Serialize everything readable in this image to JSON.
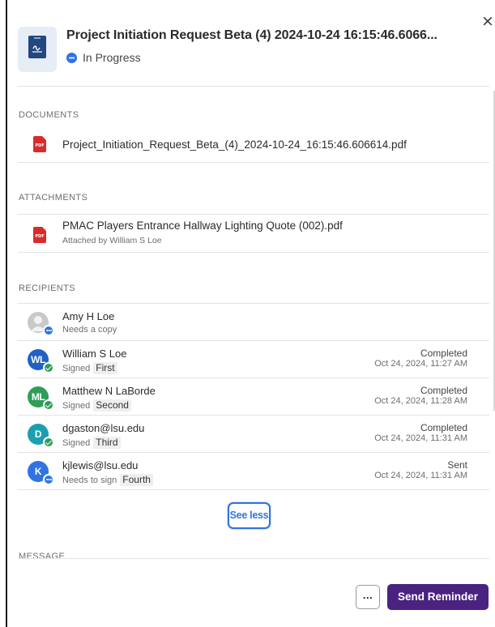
{
  "panel": {
    "close_glyph": "×",
    "title": "Project Initiation Request Beta (4) 2024-10-24 16:15:46.6066...",
    "status": "In Progress",
    "status_color": "#2f74e0"
  },
  "documents": {
    "label": "DOCUMENTS",
    "items": [
      {
        "name": "Project_Initiation_Request_Beta_(4)_2024-10-24_16:15:46.606614.pdf",
        "icon": "pdf-icon",
        "icon_label": "PDF"
      }
    ]
  },
  "attachments": {
    "label": "ATTACHMENTS",
    "items": [
      {
        "name": "PMAC Players Entrance Hallway Lighting Quote (002).pdf",
        "attached_by": "Attached by William S Loe",
        "icon": "pdf-icon",
        "icon_label": "PDF"
      }
    ]
  },
  "recipients": {
    "label": "RECIPIENTS",
    "items": [
      {
        "initials": "",
        "name": "Amy H Loe",
        "status": "Needs a copy",
        "order": "",
        "state": "",
        "date": "",
        "avatar_color": "#c9c9c9",
        "badge": "in-progress"
      },
      {
        "initials": "WL",
        "name": "William S Loe",
        "status": "Signed",
        "order": "First",
        "state": "Completed",
        "date": "Oct 24, 2024, 11:27 AM",
        "avatar_color": "#2261c4",
        "badge": "completed"
      },
      {
        "initials": "ML",
        "name": "Matthew N LaBorde",
        "status": "Signed",
        "order": "Second",
        "state": "Completed",
        "date": "Oct 24, 2024, 11:28 AM",
        "avatar_color": "#2e9e57",
        "badge": "completed"
      },
      {
        "initials": "D",
        "name": "dgaston@lsu.edu",
        "status": "Signed",
        "order": "Third",
        "state": "Completed",
        "date": "Oct 24, 2024, 11:31 AM",
        "avatar_color": "#1b9fb0",
        "badge": "completed"
      },
      {
        "initials": "K",
        "name": "kjlewis@lsu.edu",
        "status": "Needs to sign",
        "order": "Fourth",
        "state": "Sent",
        "date": "Oct 24, 2024, 11:31 AM",
        "avatar_color": "#2f74e0",
        "badge": "in-progress"
      }
    ],
    "see_less_label": "See less"
  },
  "message": {
    "label": "MESSAGE"
  },
  "footer": {
    "more_label": "...",
    "send_reminder_label": "Send Reminder",
    "accent_color": "#4a2381"
  }
}
